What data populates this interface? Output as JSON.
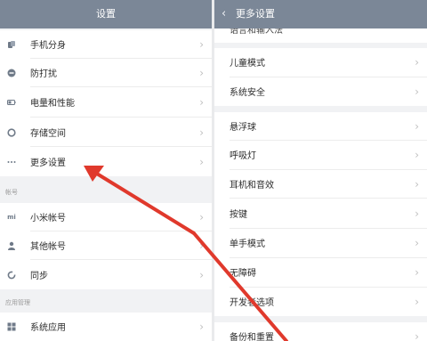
{
  "left": {
    "title": "设置",
    "items": [
      {
        "label": "手机分身",
        "icon": "phone-clone-icon"
      },
      {
        "label": "防打扰",
        "icon": "do-not-disturb-icon"
      },
      {
        "label": "电量和性能",
        "icon": "battery-icon"
      },
      {
        "label": "存储空间",
        "icon": "storage-icon"
      },
      {
        "label": "更多设置",
        "icon": "more-dots-icon"
      },
      {
        "label": "小米帐号",
        "icon": "mi-account-icon"
      },
      {
        "label": "其他帐号",
        "icon": "person-icon"
      },
      {
        "label": "同步",
        "icon": "sync-icon"
      },
      {
        "label": "系统应用",
        "icon": "apps-icon"
      }
    ],
    "sections": {
      "account": "帐号",
      "apps": "应用管理"
    }
  },
  "right": {
    "title": "更多设置",
    "partial_top": "语言和输入法",
    "items": [
      {
        "label": "儿童模式"
      },
      {
        "label": "系统安全"
      },
      {
        "label": "悬浮球"
      },
      {
        "label": "呼吸灯"
      },
      {
        "label": "耳机和音效"
      },
      {
        "label": "按键"
      },
      {
        "label": "单手模式"
      },
      {
        "label": "无障碍"
      },
      {
        "label": "开发者选项"
      },
      {
        "label": "备份和重置"
      }
    ]
  },
  "colors": {
    "header": "#7b8797",
    "arrow": "#e0392c"
  }
}
